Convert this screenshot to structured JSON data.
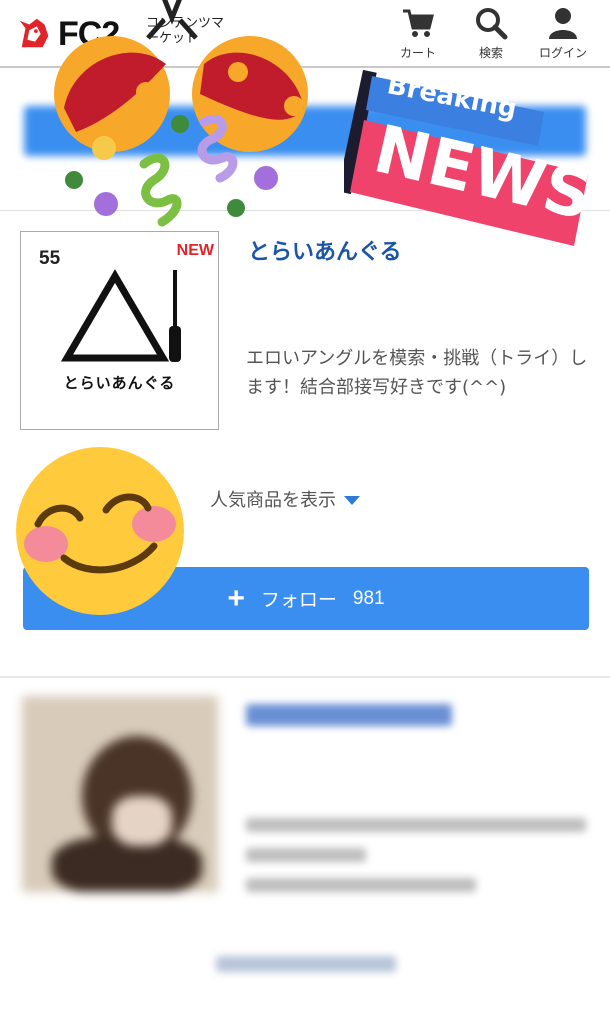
{
  "header": {
    "logo_text": "FC2",
    "logo_sub": "コンテンツマーケット",
    "nav": [
      {
        "label": "カート",
        "icon": "cart-icon"
      },
      {
        "label": "検索",
        "icon": "search-icon"
      },
      {
        "label": "ログイン",
        "icon": "user-icon"
      }
    ]
  },
  "shop": {
    "thumb_count": "55",
    "thumb_badge": "NEW",
    "thumb_caption": "とらいあんぐる",
    "name": "とらいあんぐる",
    "description": "エロいアングルを模索・挑戦（トライ）します！結合部接写好きです(^^)",
    "popular_toggle": "人気商品を表示",
    "follow_label": "フォロー",
    "follow_count": "981"
  },
  "stickers": {
    "news_top": "Breaking",
    "news_bottom": "NEWS"
  },
  "colors": {
    "accent_blue": "#3a8ef0",
    "shop_name_blue": "#1a55a8",
    "badge_red": "#e0242b",
    "news_pink": "#f0436b"
  }
}
